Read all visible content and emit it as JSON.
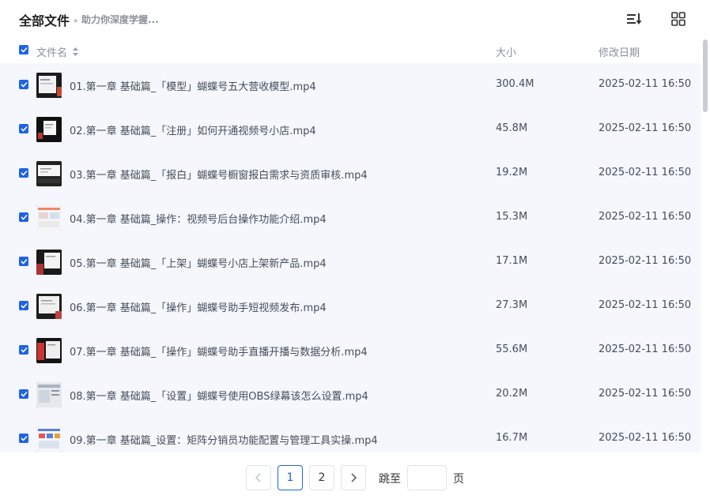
{
  "header": {
    "title": "全部文件",
    "breadcrumb": "助力你深度学握..."
  },
  "columns": {
    "name": "文件名",
    "size": "大小",
    "date": "修改日期"
  },
  "files": [
    {
      "name": "01.第一章 基础篇_「模型」蝴蝶号五大营收模型.mp4",
      "size": "300.4M",
      "date": "2025-02-11 16:50"
    },
    {
      "name": "02.第一章 基础篇_「注册」如何开通视频号小店.mp4",
      "size": "45.8M",
      "date": "2025-02-11 16:50"
    },
    {
      "name": "03.第一章 基础篇_「报白」蝴蝶号橱窗报白需求与资质审核.mp4",
      "size": "19.2M",
      "date": "2025-02-11 16:50"
    },
    {
      "name": "04.第一章 基础篇_操作：视频号后台操作功能介绍.mp4",
      "size": "15.3M",
      "date": "2025-02-11 16:50"
    },
    {
      "name": "05.第一章 基础篇_「上架」蝴蝶号小店上架新产品.mp4",
      "size": "17.1M",
      "date": "2025-02-11 16:50"
    },
    {
      "name": "06.第一章 基础篇_「操作」蝴蝶号助手短视频发布.mp4",
      "size": "27.3M",
      "date": "2025-02-11 16:50"
    },
    {
      "name": "07.第一章 基础篇_「操作」蝴蝶号助手直播开播与数据分析.mp4",
      "size": "55.6M",
      "date": "2025-02-11 16:50"
    },
    {
      "name": "08.第一章 基础篇_「设置」蝴蝶号使用OBS绿幕该怎么设置.mp4",
      "size": "20.2M",
      "date": "2025-02-11 16:50"
    },
    {
      "name": "09.第一章 基础篇_设置：矩阵分销员功能配置与管理工具实操.mp4",
      "size": "16.7M",
      "date": "2025-02-11 16:50"
    }
  ],
  "pagination": {
    "pages": [
      "1",
      "2"
    ],
    "current": "1",
    "jump_label": "跳至",
    "jump_value": "",
    "page_unit": "页"
  },
  "colors": {
    "accent": "#1f63e6",
    "list_bg": "#f5f7fc"
  },
  "icons": {
    "sort": "sort-icon",
    "grid": "grid-view-icon",
    "prev": "chevron-left-icon",
    "next": "chevron-right-icon"
  }
}
